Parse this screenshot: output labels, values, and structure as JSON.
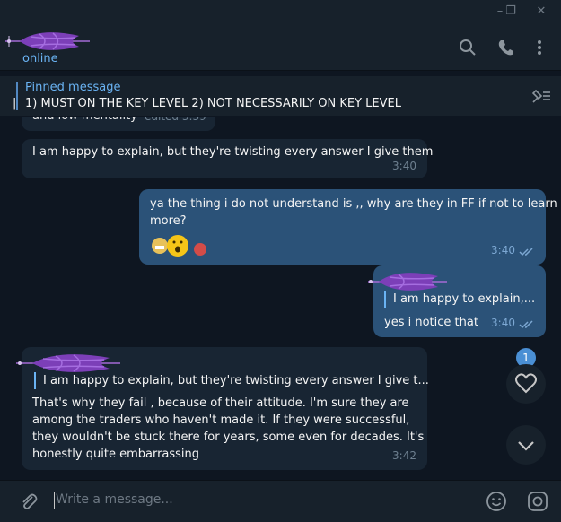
{
  "window": {
    "minimize_glyph": "–",
    "maximize_glyph": "❐",
    "close_glyph": "✕"
  },
  "header": {
    "status": "online",
    "icons": [
      "search-icon",
      "phone-icon",
      "more-vertical-icon"
    ]
  },
  "pinned": {
    "title": "Pinned message",
    "prefix": "|",
    "text": "1) MUST ON THE KEY LEVEL  2) NOT NECESSARILY ON KEY LEVEL",
    "icon": "unpin-list-icon"
  },
  "messages": {
    "m0": {
      "partial_text": "and low mentality",
      "edited": "edited 3:39"
    },
    "m1": {
      "text": "I am happy to explain, but they're twisting every answer I give them",
      "time": "3:40"
    },
    "m2": {
      "line1": "ya the thing i do not understand is ,, why are they in FF if not to learn",
      "line2": "more?",
      "time": "3:40",
      "reactions": [
        "grimacing-emoji",
        "open-mouth-emoji",
        "red-circle"
      ]
    },
    "m3": {
      "quote": "I am happy to explain,...",
      "text": "yes i notice that",
      "time": "3:40"
    },
    "m4": {
      "quote": "I am happy to explain, but they're twisting every answer I give t...",
      "lines": [
        "That's why they fail , because of their attitude. I'm sure they are",
        "among the traders who haven't made it. If they were successful,",
        "they wouldn't be stuck there for years, some even for decades. It's",
        "honestly quite embarrassing"
      ],
      "time": "3:42"
    }
  },
  "fab": {
    "unread_count": "1",
    "icons": [
      "heart-icon",
      "chevron-down-icon"
    ]
  },
  "composer": {
    "placeholder": "Write a message...",
    "icons": [
      "paperclip-icon",
      "emoji-icon",
      "camera-icon"
    ]
  },
  "colors": {
    "accent": "#6ab3f3",
    "out_bubble": "#2b5278",
    "in_bubble": "#182533",
    "bg": "#0e1621",
    "panel": "#17212b"
  }
}
